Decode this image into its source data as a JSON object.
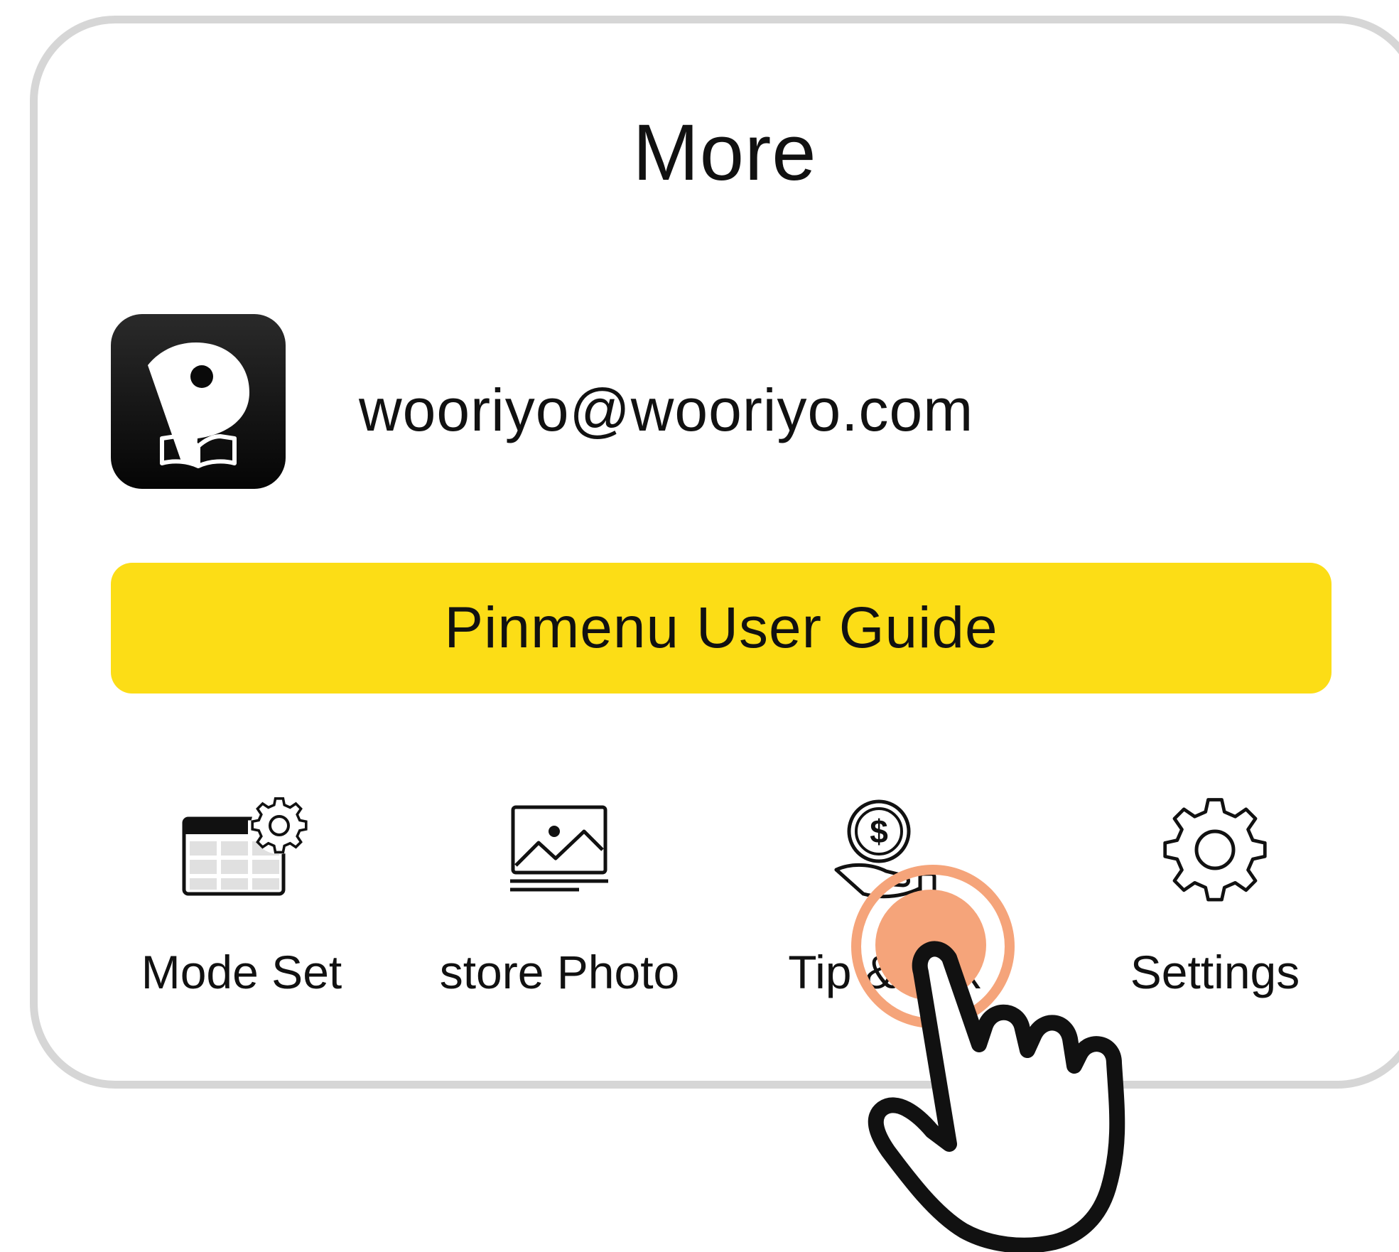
{
  "header": {
    "title": "More"
  },
  "account": {
    "email": "wooriyo@wooriyo.com",
    "avatar_icon": "pin-book-logo-icon"
  },
  "guide_button": {
    "label": "Pinmenu User Guide",
    "color": "#fcdd16"
  },
  "menu": [
    {
      "label": "Mode Set",
      "icon": "mode-set-icon"
    },
    {
      "label": "store Photo",
      "icon": "photo-icon"
    },
    {
      "label": "Tip & Tax",
      "icon": "tip-money-icon"
    },
    {
      "label": "Settings",
      "icon": "gear-icon"
    }
  ],
  "tap_highlight": {
    "color": "#f5a47a",
    "target": "Tip & Tax"
  }
}
